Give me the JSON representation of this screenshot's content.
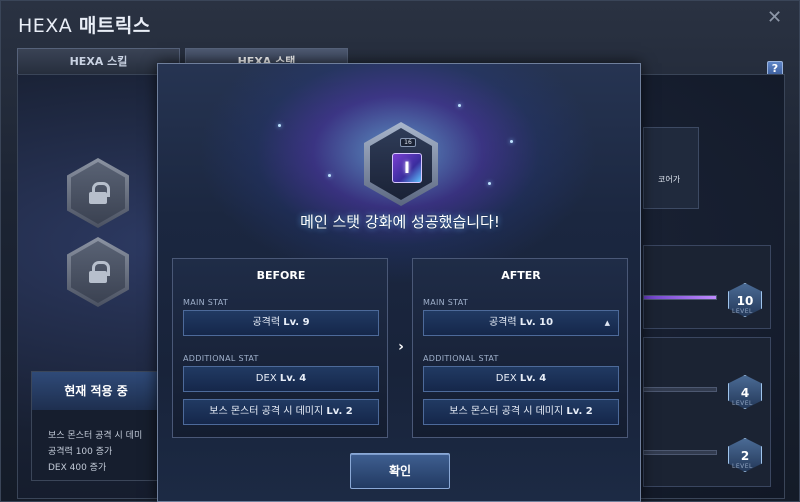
{
  "window": {
    "title_prefix": "HEXA",
    "title_main": "매트릭스",
    "close_icon": "✕",
    "help_label": "?"
  },
  "tabs": [
    {
      "label": "HEXA 스킬",
      "active": false
    },
    {
      "label": "HEXA 스탯",
      "active": true
    }
  ],
  "background": {
    "current_applied": {
      "title": "현재 적용 중",
      "lines": [
        "보스 몬스터 공격 시 데미",
        "공격력 100 증가",
        "DEX 400 증가"
      ]
    },
    "side_note": [
      "코어가"
    ],
    "levels": [
      {
        "value": "10",
        "unit": "LEVEL"
      },
      {
        "value": "4",
        "unit": "LEVEL"
      },
      {
        "value": "2",
        "unit": "LEVEL"
      }
    ]
  },
  "modal": {
    "skill_level_badge": "16",
    "skill_icon_glyph": "I",
    "success_message": "메인 스탯 강화에 성공했습니다!",
    "before": {
      "title": "BEFORE",
      "main_stat_label": "MAIN STAT",
      "main_stat_name": "공격력",
      "main_stat_level": "Lv. 9",
      "additional_stat_label": "ADDITIONAL STAT",
      "additional": [
        {
          "name": "DEX",
          "level": "Lv. 4"
        },
        {
          "name": "보스 몬스터 공격 시 데미지",
          "level": "Lv. 2"
        }
      ]
    },
    "after": {
      "title": "AFTER",
      "main_stat_label": "MAIN STAT",
      "main_stat_name": "공격력",
      "main_stat_level": "Lv. 10",
      "main_stat_indicator": "▲",
      "additional_stat_label": "ADDITIONAL STAT",
      "additional": [
        {
          "name": "DEX",
          "level": "Lv. 4"
        },
        {
          "name": "보스 몬스터 공격 시 데미지",
          "level": "Lv. 2"
        }
      ]
    },
    "arrow": "›",
    "confirm_label": "확인"
  },
  "colors": {
    "accent": "#8fd0ff",
    "button": "#2e4a7a",
    "stat_fill": "#c08bff"
  }
}
